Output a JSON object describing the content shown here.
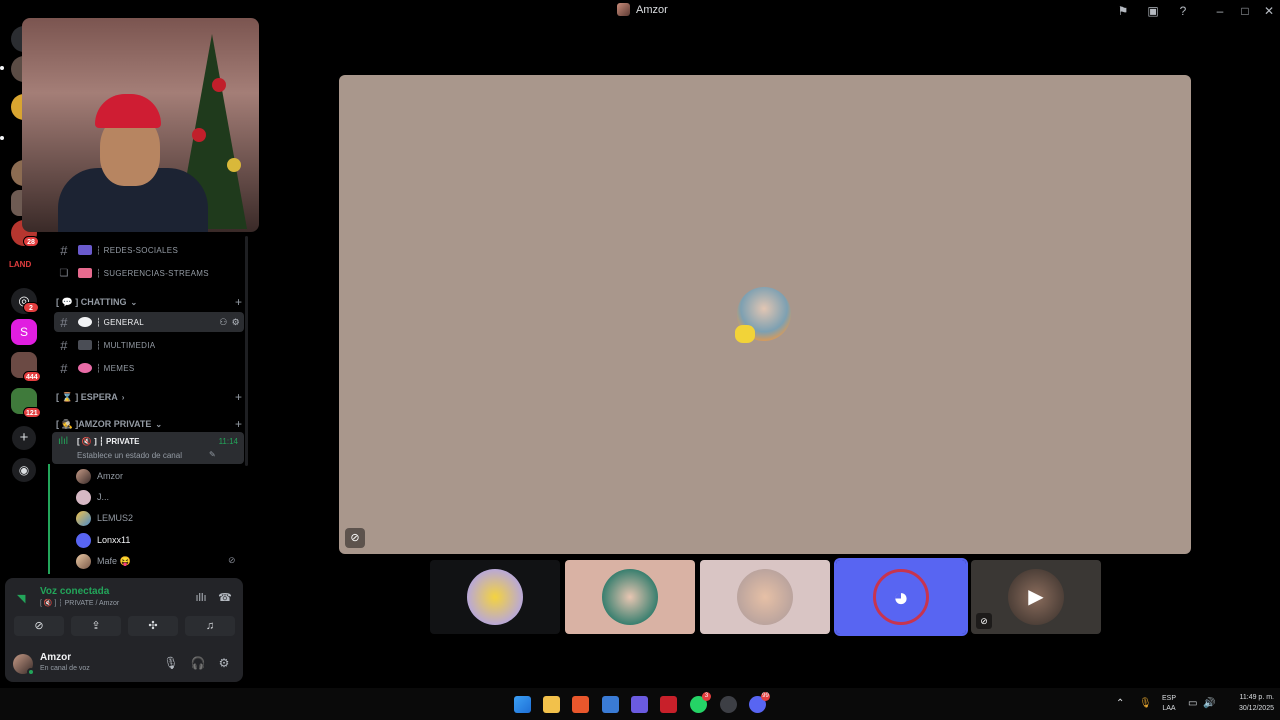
{
  "window": {
    "title": "Amzor",
    "accent": "#5865f2",
    "online_color": "#23a55a"
  },
  "server_rail": {
    "badges": [
      "28",
      "2",
      "444",
      "121"
    ],
    "logo_text": "LAND"
  },
  "channels": {
    "top_items": [
      {
        "label": "┆ REDES-SOCIALES",
        "icon": "hash-icon"
      },
      {
        "label": "┆ SUGERENCIAS-STREAMS",
        "icon": "forum-icon"
      }
    ],
    "categories": [
      {
        "label": "[ 💬 ] CHATTING"
      },
      {
        "label": "[ ⌛ ] ESPERA"
      },
      {
        "label": "[ 🕵 ]AMZOR PRIVATE"
      }
    ],
    "chatting_items": [
      {
        "label": "┆ GENERAL"
      },
      {
        "label": "┆ MULTIMEDIA"
      },
      {
        "label": "┆ MEMES"
      }
    ],
    "voice_channel": {
      "name": "[ 🔇 ] ┆ PRIVATE",
      "time": "11:14",
      "status": "Establece un estado de canal"
    },
    "members": [
      {
        "name": "Amzor"
      },
      {
        "name": "J..."
      },
      {
        "name": "LEMUS2"
      },
      {
        "name": "Lonxx11"
      },
      {
        "name": "Mafe 😝"
      }
    ]
  },
  "voice_panel": {
    "title": "Voz conectada",
    "subtitle": "[ 🔇 ] ┆ PRIVATE / Amzor"
  },
  "user_panel": {
    "name": "Amzor",
    "status": "En canal de voz"
  },
  "taskbar": {
    "lang_top": "ESP",
    "lang_bottom": "LAA",
    "time": "11:49 p. m.",
    "date": "30/12/2025",
    "whatsapp_badge": "3",
    "discord_badge": "99"
  }
}
